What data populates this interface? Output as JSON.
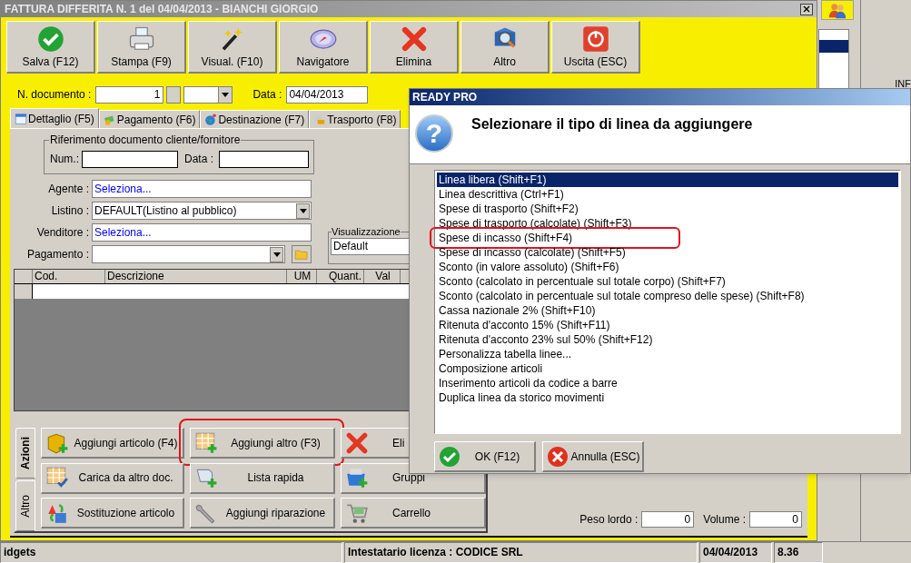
{
  "main_window": {
    "title": "FATTURA DIFFERITA N. 1 del 04/04/2013 - BIANCHI GIORGIO",
    "toolbar": [
      "Salva (F12)",
      "Stampa (F9)",
      "Visual. (F10)",
      "Navigatore",
      "Elimina",
      "Altro",
      "Uscita (ESC)"
    ],
    "document_number": {
      "label": "N. documento :",
      "value": "1"
    },
    "date": {
      "label": "Data :",
      "value": "04/04/2013"
    },
    "tabs": [
      {
        "label": "Dettaglio (F5)",
        "selected": true
      },
      {
        "label": "Pagamento (F6)",
        "selected": false
      },
      {
        "label": "Destinazione (F7)",
        "selected": false
      },
      {
        "label": "Trasporto (F8)",
        "selected": false
      }
    ],
    "reference_group": {
      "title": "Riferimento documento cliente/fornitore",
      "num_label": "Num.:",
      "date_label": "Data :"
    },
    "fields": [
      {
        "label": "Agente :",
        "value": "Seleziona...",
        "kind": "link"
      },
      {
        "label": "Listino :",
        "value": "DEFAULT(Listino al pubblico)",
        "kind": "combo"
      },
      {
        "label": "Venditore :",
        "value": "Seleziona...",
        "kind": "link"
      },
      {
        "label": "Pagamento :",
        "kind": "combo_folder"
      }
    ],
    "view_group": {
      "title": "Visualizzazione",
      "value": "Default"
    },
    "table": {
      "columns": [
        "Cod.",
        "Descrizione",
        "UM",
        "Quant.",
        "Val"
      ]
    },
    "action_tabs": [
      {
        "label": "Azioni",
        "selected": true
      },
      {
        "label": "Altro",
        "selected": false
      }
    ],
    "actions": [
      {
        "label": "Aggiungi articolo (F4)",
        "highlighted": false
      },
      {
        "label": "Aggiungi altro (F3)",
        "highlighted": true
      },
      {
        "label": "Eli",
        "highlighted": false
      },
      {
        "label": "Carica da altro doc.",
        "highlighted": false
      },
      {
        "label": "Lista rapida",
        "highlighted": false
      },
      {
        "label": "Gruppi",
        "highlighted": false
      },
      {
        "label": "Sostituzione articolo",
        "highlighted": false
      },
      {
        "label": "Aggiungi riparazione",
        "highlighted": false
      },
      {
        "label": "Carrello",
        "highlighted": false
      }
    ],
    "totals": [
      {
        "label": "Peso lordo :",
        "value": "0"
      },
      {
        "label": "Volume :",
        "value": "0"
      }
    ]
  },
  "side_panel": {
    "label": "INF"
  },
  "dialog": {
    "title": "READY PRO",
    "help_glyph": "?",
    "message": "Selezionare il tipo di linea da aggiungere",
    "options": [
      {
        "label": "Linea libera (Shift+F1)",
        "selected": true,
        "highlighted": false
      },
      {
        "label": "Linea descrittiva (Ctrl+F1)",
        "selected": false,
        "highlighted": false
      },
      {
        "label": "Spese di trasporto (Shift+F2)",
        "selected": false,
        "highlighted": false
      },
      {
        "label": "Spese di trasporto (calcolate) (Shift+F3)",
        "selected": false,
        "highlighted": false
      },
      {
        "label": "Spese di incasso (Shift+F4)",
        "selected": false,
        "highlighted": true
      },
      {
        "label": "Spese di incasso (calcolate) (Shift+F5)",
        "selected": false,
        "highlighted": false
      },
      {
        "label": "Sconto (in valore assoluto) (Shift+F6)",
        "selected": false,
        "highlighted": false
      },
      {
        "label": "Sconto (calcolato in percentuale sul totale corpo) (Shift+F7)",
        "selected": false,
        "highlighted": false
      },
      {
        "label": "Sconto (calcolato in percentuale sul totale compreso delle spese) (Shift+F8)",
        "selected": false,
        "highlighted": false
      },
      {
        "label": "Cassa nazionale 2% (Shift+F10)",
        "selected": false,
        "highlighted": false
      },
      {
        "label": "Ritenuta d'acconto 15% (Shift+F11)",
        "selected": false,
        "highlighted": false
      },
      {
        "label": "Ritenuta d'acconto 23% sul 50% (Shift+F12)",
        "selected": false,
        "highlighted": false
      },
      {
        "label": "Personalizza tabella linee...",
        "selected": false,
        "highlighted": false
      },
      {
        "label": "Composizione articoli",
        "selected": false,
        "highlighted": false
      },
      {
        "label": "Inserimento articoli da codice a barre",
        "selected": false,
        "highlighted": false
      },
      {
        "label": "Duplica linea da storico movimenti",
        "selected": false,
        "highlighted": false
      }
    ],
    "buttons": [
      {
        "label": "OK (F12)",
        "kind": "ok"
      },
      {
        "label": "Annulla (ESC)",
        "kind": "cancel"
      }
    ]
  },
  "status_bar": [
    "idgets",
    "Intestatario licenza : CODICE SRL",
    "04/04/2013",
    "8.36"
  ]
}
